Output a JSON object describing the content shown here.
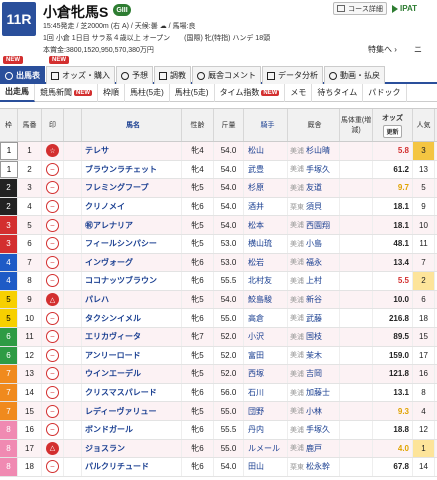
{
  "race": {
    "number": "11R",
    "title": "小倉牝馬S",
    "grade": "GIII",
    "info1": "15:45発走 / 芝2000m (右 A) / 天候:曇 ☁ / 馬場:良",
    "info2": "1回 小倉 1日目 サラ系４歳以上 オープン　　(国際) 牝(特指) ハンデ 18頭",
    "info3": "本賞金:3800,1520,950,570,380万円"
  },
  "header": {
    "course_button": "コース詳細",
    "ipat_label": "IPAT",
    "special_link": "特集へ",
    "more_link": "ニ"
  },
  "tabs": [
    {
      "label": "出馬表",
      "new": true
    },
    {
      "label": "オッズ・購入",
      "new": true
    },
    {
      "label": "予想",
      "new": false
    },
    {
      "label": "調教",
      "new": false
    },
    {
      "label": "厩舎コメント",
      "new": false
    },
    {
      "label": "データ分析",
      "new": false
    },
    {
      "label": "動画・払戻",
      "new": false
    }
  ],
  "subtabs": [
    {
      "label": "出走馬",
      "new": false
    },
    {
      "label": "競馬新聞",
      "new": true
    },
    {
      "label": "枠順",
      "new": false
    },
    {
      "label": "馬柱(5走)",
      "new": false
    },
    {
      "label": "馬柱(5走)",
      "new": false
    },
    {
      "label": "タイム指数",
      "new": true
    },
    {
      "label": "メモ",
      "new": false
    },
    {
      "label": "待ちタイム",
      "new": false
    },
    {
      "label": "パドック",
      "new": false
    }
  ],
  "table": {
    "headers": {
      "waku": "枠",
      "num": "馬番",
      "mark": "印",
      "check": "",
      "name": "馬名",
      "sex": "性齢",
      "kin": "斤量",
      "jockey": "騎手",
      "stable": "厩舎",
      "weight": "馬体重(増減)",
      "odds": "オッズ",
      "odds_refresh": "更新",
      "pop": "人気"
    },
    "rows": [
      {
        "waku": "1",
        "num": "1",
        "mark": "☆",
        "mark_type": "star",
        "name": "テレサ",
        "sex": "牝4",
        "kin": "54.0",
        "jockey": "松山",
        "loc": "美浦",
        "trainer": "杉山晴",
        "weight": "",
        "odds": "5.8",
        "odds_color": "red",
        "pop": "3"
      },
      {
        "waku": "1",
        "num": "2",
        "mark": "–",
        "mark_type": "dash",
        "name": "ブラウンラチェット",
        "sex": "牝4",
        "kin": "54.0",
        "jockey": "武豊",
        "loc": "美浦",
        "trainer": "手塚久",
        "weight": "",
        "odds": "61.2",
        "odds_color": "black",
        "pop": "13"
      },
      {
        "waku": "2",
        "num": "3",
        "mark": "–",
        "mark_type": "dash",
        "name": "フレミングフープ",
        "sex": "牝5",
        "kin": "54.0",
        "jockey": "杉原",
        "loc": "美浦",
        "trainer": "友道",
        "weight": "",
        "odds": "9.7",
        "odds_color": "orange",
        "pop": "5"
      },
      {
        "waku": "2",
        "num": "4",
        "mark": "–",
        "mark_type": "dash",
        "name": "クリノメイ",
        "sex": "牝6",
        "kin": "54.0",
        "jockey": "酒井",
        "loc": "栗東",
        "trainer": "須貝",
        "weight": "",
        "odds": "18.1",
        "odds_color": "black",
        "pop": "9"
      },
      {
        "waku": "3",
        "num": "5",
        "mark": "–",
        "mark_type": "dash",
        "name": "㊗アレナリア",
        "sex": "牝5",
        "kin": "54.0",
        "jockey": "松本",
        "loc": "美浦",
        "trainer": "西園翔",
        "weight": "",
        "odds": "18.1",
        "odds_color": "black",
        "pop": "10"
      },
      {
        "waku": "3",
        "num": "6",
        "mark": "–",
        "mark_type": "dash",
        "name": "フィールシンパシー",
        "sex": "牝5",
        "kin": "53.0",
        "jockey": "横山琉",
        "loc": "美浦",
        "trainer": "小島",
        "weight": "",
        "odds": "48.1",
        "odds_color": "black",
        "pop": "11"
      },
      {
        "waku": "4",
        "num": "7",
        "mark": "–",
        "mark_type": "dash",
        "name": "インヴォーグ",
        "sex": "牝6",
        "kin": "53.0",
        "jockey": "松岩",
        "loc": "美浦",
        "trainer": "福永",
        "weight": "",
        "odds": "13.4",
        "odds_color": "black",
        "pop": "7"
      },
      {
        "waku": "4",
        "num": "8",
        "mark": "–",
        "mark_type": "dash",
        "name": "ココナッツブラウン",
        "sex": "牝6",
        "kin": "55.5",
        "jockey": "北村友",
        "loc": "美浦",
        "trainer": "上村",
        "weight": "",
        "odds": "5.5",
        "odds_color": "red",
        "pop": "2"
      },
      {
        "waku": "5",
        "num": "9",
        "mark": "△",
        "mark_type": "circle",
        "name": "パレハ",
        "sex": "牝5",
        "kin": "54.0",
        "jockey": "鮫島駿",
        "loc": "美浦",
        "trainer": "新谷",
        "weight": "",
        "odds": "10.0",
        "odds_color": "black",
        "pop": "6"
      },
      {
        "waku": "5",
        "num": "10",
        "mark": "–",
        "mark_type": "dash",
        "name": "タクシンイメル",
        "sex": "牝6",
        "kin": "55.0",
        "jockey": "高倉",
        "loc": "美浦",
        "trainer": "武藤",
        "weight": "",
        "odds": "216.8",
        "odds_color": "black",
        "pop": "18"
      },
      {
        "waku": "6",
        "num": "11",
        "mark": "–",
        "mark_type": "dash",
        "name": "エリカヴィータ",
        "sex": "牝7",
        "kin": "52.0",
        "jockey": "小沢",
        "loc": "美浦",
        "trainer": "国枝",
        "weight": "",
        "odds": "89.5",
        "odds_color": "black",
        "pop": "15"
      },
      {
        "waku": "6",
        "num": "12",
        "mark": "–",
        "mark_type": "dash",
        "name": "アンリーロード",
        "sex": "牝5",
        "kin": "52.0",
        "jockey": "富田",
        "loc": "美浦",
        "trainer": "茉木",
        "weight": "",
        "odds": "159.0",
        "odds_color": "black",
        "pop": "17"
      },
      {
        "waku": "7",
        "num": "13",
        "mark": "–",
        "mark_type": "dash",
        "name": "ウインエーデル",
        "sex": "牝5",
        "kin": "52.0",
        "jockey": "西塚",
        "loc": "美浦",
        "trainer": "吉岡",
        "weight": "",
        "odds": "121.8",
        "odds_color": "black",
        "pop": "16"
      },
      {
        "waku": "7",
        "num": "14",
        "mark": "–",
        "mark_type": "dash",
        "name": "クリスマスパレード",
        "sex": "牝6",
        "kin": "56.0",
        "jockey": "石川",
        "loc": "美浦",
        "trainer": "加藤士",
        "weight": "",
        "odds": "13.1",
        "odds_color": "black",
        "pop": "8"
      },
      {
        "waku": "7",
        "num": "15",
        "mark": "–",
        "mark_type": "dash",
        "name": "レディーヴァリュー",
        "sex": "牝5",
        "kin": "55.0",
        "jockey": "団野",
        "loc": "美浦",
        "trainer": "小林",
        "weight": "",
        "odds": "9.3",
        "odds_color": "orange",
        "pop": "4"
      },
      {
        "waku": "8",
        "num": "16",
        "mark": "–",
        "mark_type": "dash",
        "name": "ボンドガール",
        "sex": "牝6",
        "kin": "55.5",
        "jockey": "丹内",
        "loc": "美浦",
        "trainer": "手塚久",
        "weight": "",
        "odds": "18.8",
        "odds_color": "black",
        "pop": "12"
      },
      {
        "waku": "8",
        "num": "17",
        "mark": "△",
        "mark_type": "circle",
        "name": "ジョスラン",
        "sex": "牝6",
        "kin": "55.0",
        "jockey": "ルメール",
        "loc": "美浦",
        "trainer": "鹿戸",
        "weight": "",
        "odds": "4.0",
        "odds_color": "orange",
        "pop": "1"
      },
      {
        "waku": "8",
        "num": "18",
        "mark": "–",
        "mark_type": "dash",
        "name": "パルクリチュード",
        "sex": "牝6",
        "kin": "54.0",
        "jockey": "田山",
        "loc": "栗東",
        "trainer": "松永幹",
        "weight": "",
        "odds": "67.8",
        "odds_color": "black",
        "pop": "14"
      }
    ]
  }
}
